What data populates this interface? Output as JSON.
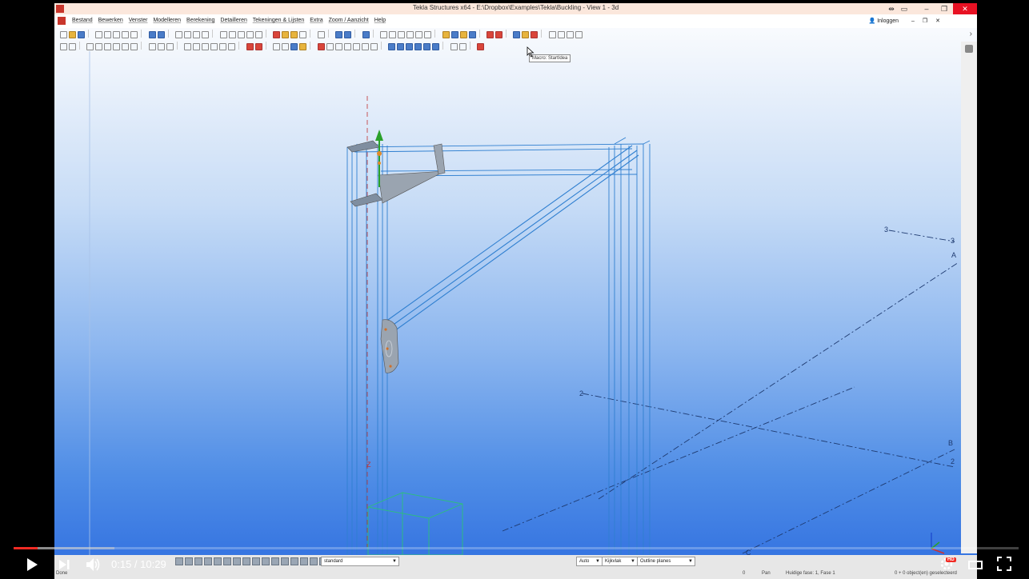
{
  "window": {
    "title": "Tekla Structures x64 - E:\\Dropbox\\Examples\\Tekla\\Buckling  - View 1 - 3d",
    "min_glyph": "–",
    "max_glyph": "❐",
    "close_glyph": "✕"
  },
  "menubar": {
    "items": [
      "Bestand",
      "Bewerken",
      "Venster",
      "Modelleren",
      "Berekening",
      "Detailleren",
      "Tekeningen & Lijsten",
      "Extra",
      "Zoom / Aanzicht",
      "Help"
    ],
    "login": "Inloggen"
  },
  "tooltip": "Macro: StartIdea",
  "view": {
    "grid_labels": [
      "3",
      "3",
      "A",
      "2",
      "B",
      "2",
      "C"
    ]
  },
  "statusbar": {
    "combo_standard": "standard",
    "combo_auto": "Auto",
    "combo_kijkvlak": "Kijkvlak",
    "combo_outline": "Outline planes",
    "done": "Done",
    "zero": "0",
    "pan": "Pan",
    "phase": "Huidige fase: 1, Fase 1",
    "selected": "0 + 0 object(en) geselecteerd"
  },
  "player": {
    "time": "0:15 / 10:29",
    "progress_fraction": 0.024,
    "buffer_fraction": 0.1,
    "hd_badge": "HD"
  },
  "colors": {
    "accent_red": "#f12b24",
    "close_red": "#e81123",
    "model_blue": "#2f7fd0"
  }
}
